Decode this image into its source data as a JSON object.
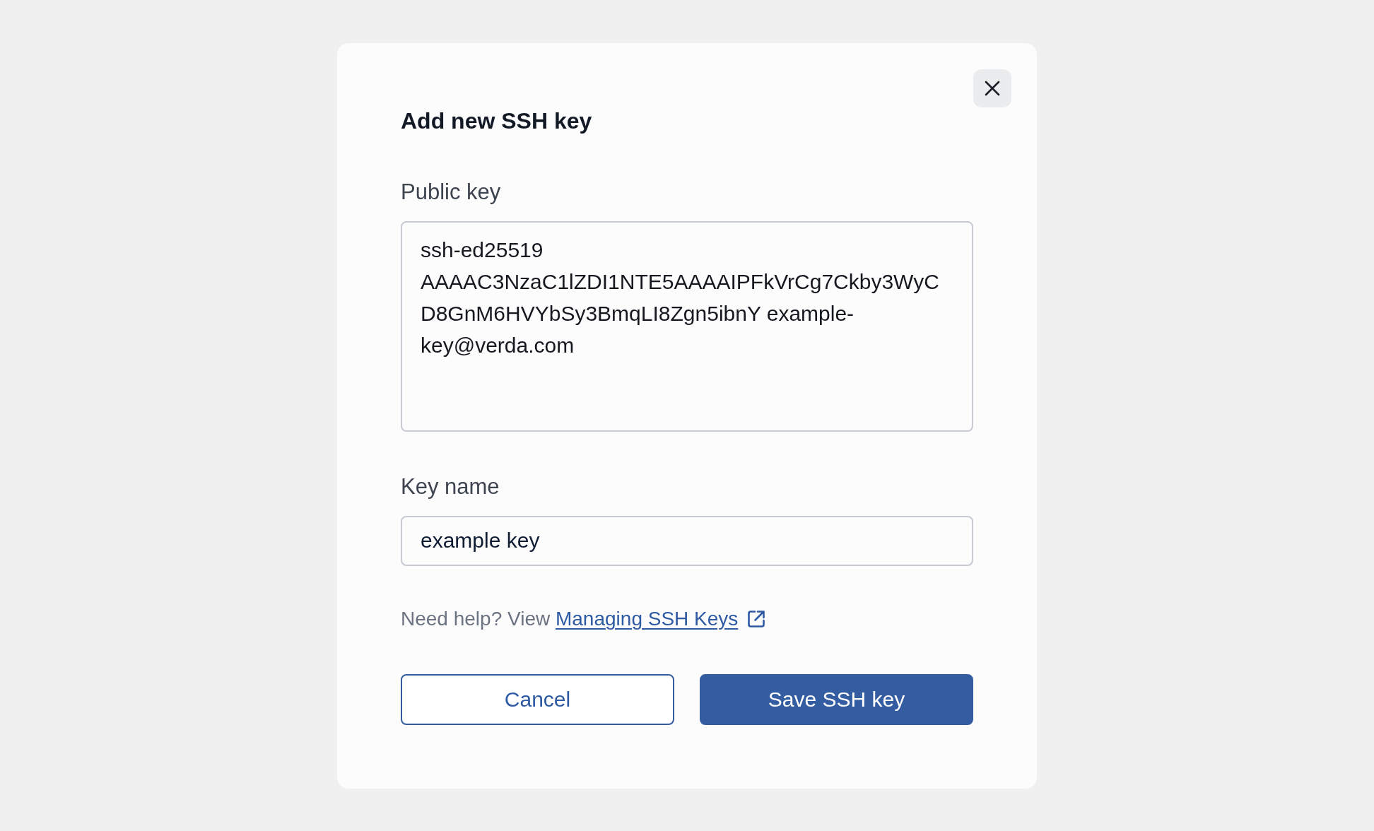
{
  "dialog": {
    "title": "Add new SSH key",
    "fields": [
      {
        "kind": "textarea",
        "label": "Public key",
        "value": "ssh-ed25519 AAAAC3NzaC1lZDI1NTE5AAAAIPFkVrCg7Ckby3WyCD8GnM6HVYbSy3BmqLI8Zgn5ibnY example-key@verda.com"
      },
      {
        "kind": "input",
        "label": "Key name",
        "value": "example key"
      }
    ],
    "help": {
      "text": "Need help? View",
      "link": "Managing SSH Keys"
    },
    "buttons": [
      {
        "kind": "secondary",
        "label": "Cancel"
      },
      {
        "kind": "primary",
        "label": "Save SSH key"
      }
    ]
  }
}
